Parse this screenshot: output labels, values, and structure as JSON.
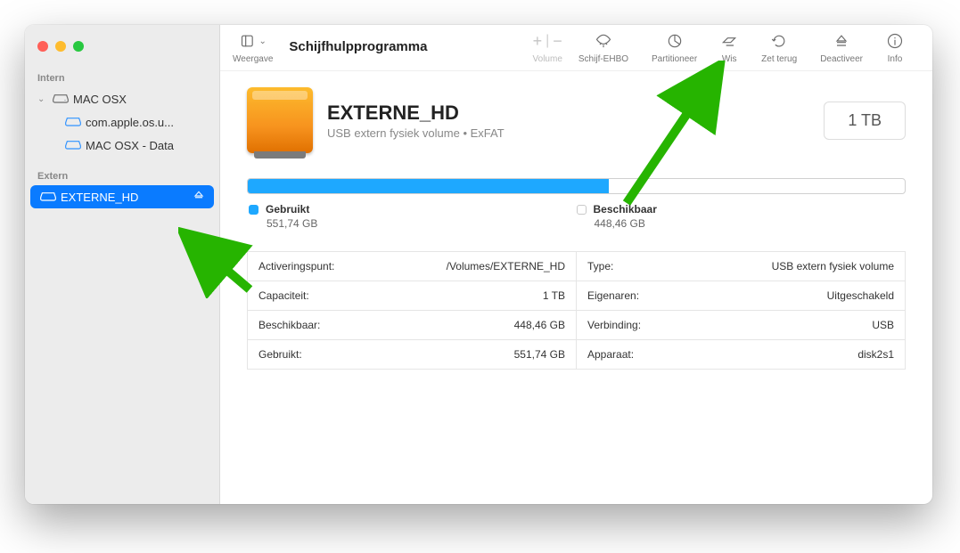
{
  "app_title": "Schijfhulpprogramma",
  "toolbar": {
    "view_label": "Weergave",
    "volume_label": "Volume",
    "firstaid_label": "Schijf-EHBO",
    "partition_label": "Partitioneer",
    "erase_label": "Wis",
    "restore_label": "Zet terug",
    "unmount_label": "Deactiveer",
    "info_label": "Info"
  },
  "sidebar": {
    "internal_heading": "Intern",
    "external_heading": "Extern",
    "items": [
      {
        "label": "MAC OSX"
      },
      {
        "label": "com.apple.os.u..."
      },
      {
        "label": "MAC OSX - Data"
      },
      {
        "label": "EXTERNE_HD"
      }
    ]
  },
  "volume": {
    "name": "EXTERNE_HD",
    "subtitle": "USB extern fysiek volume • ExFAT",
    "capacity_badge": "1 TB"
  },
  "usage": {
    "used_label": "Gebruikt",
    "used_value": "551,74 GB",
    "free_label": "Beschikbaar",
    "free_value": "448,46 GB",
    "used_pct": 55
  },
  "details": {
    "left": [
      {
        "k": "Activeringspunt:",
        "v": "/Volumes/EXTERNE_HD"
      },
      {
        "k": "Capaciteit:",
        "v": "1 TB"
      },
      {
        "k": "Beschikbaar:",
        "v": "448,46 GB"
      },
      {
        "k": "Gebruikt:",
        "v": "551,74 GB"
      }
    ],
    "right": [
      {
        "k": "Type:",
        "v": "USB extern fysiek volume"
      },
      {
        "k": "Eigenaren:",
        "v": "Uitgeschakeld"
      },
      {
        "k": "Verbinding:",
        "v": "USB"
      },
      {
        "k": "Apparaat:",
        "v": "disk2s1"
      }
    ]
  }
}
